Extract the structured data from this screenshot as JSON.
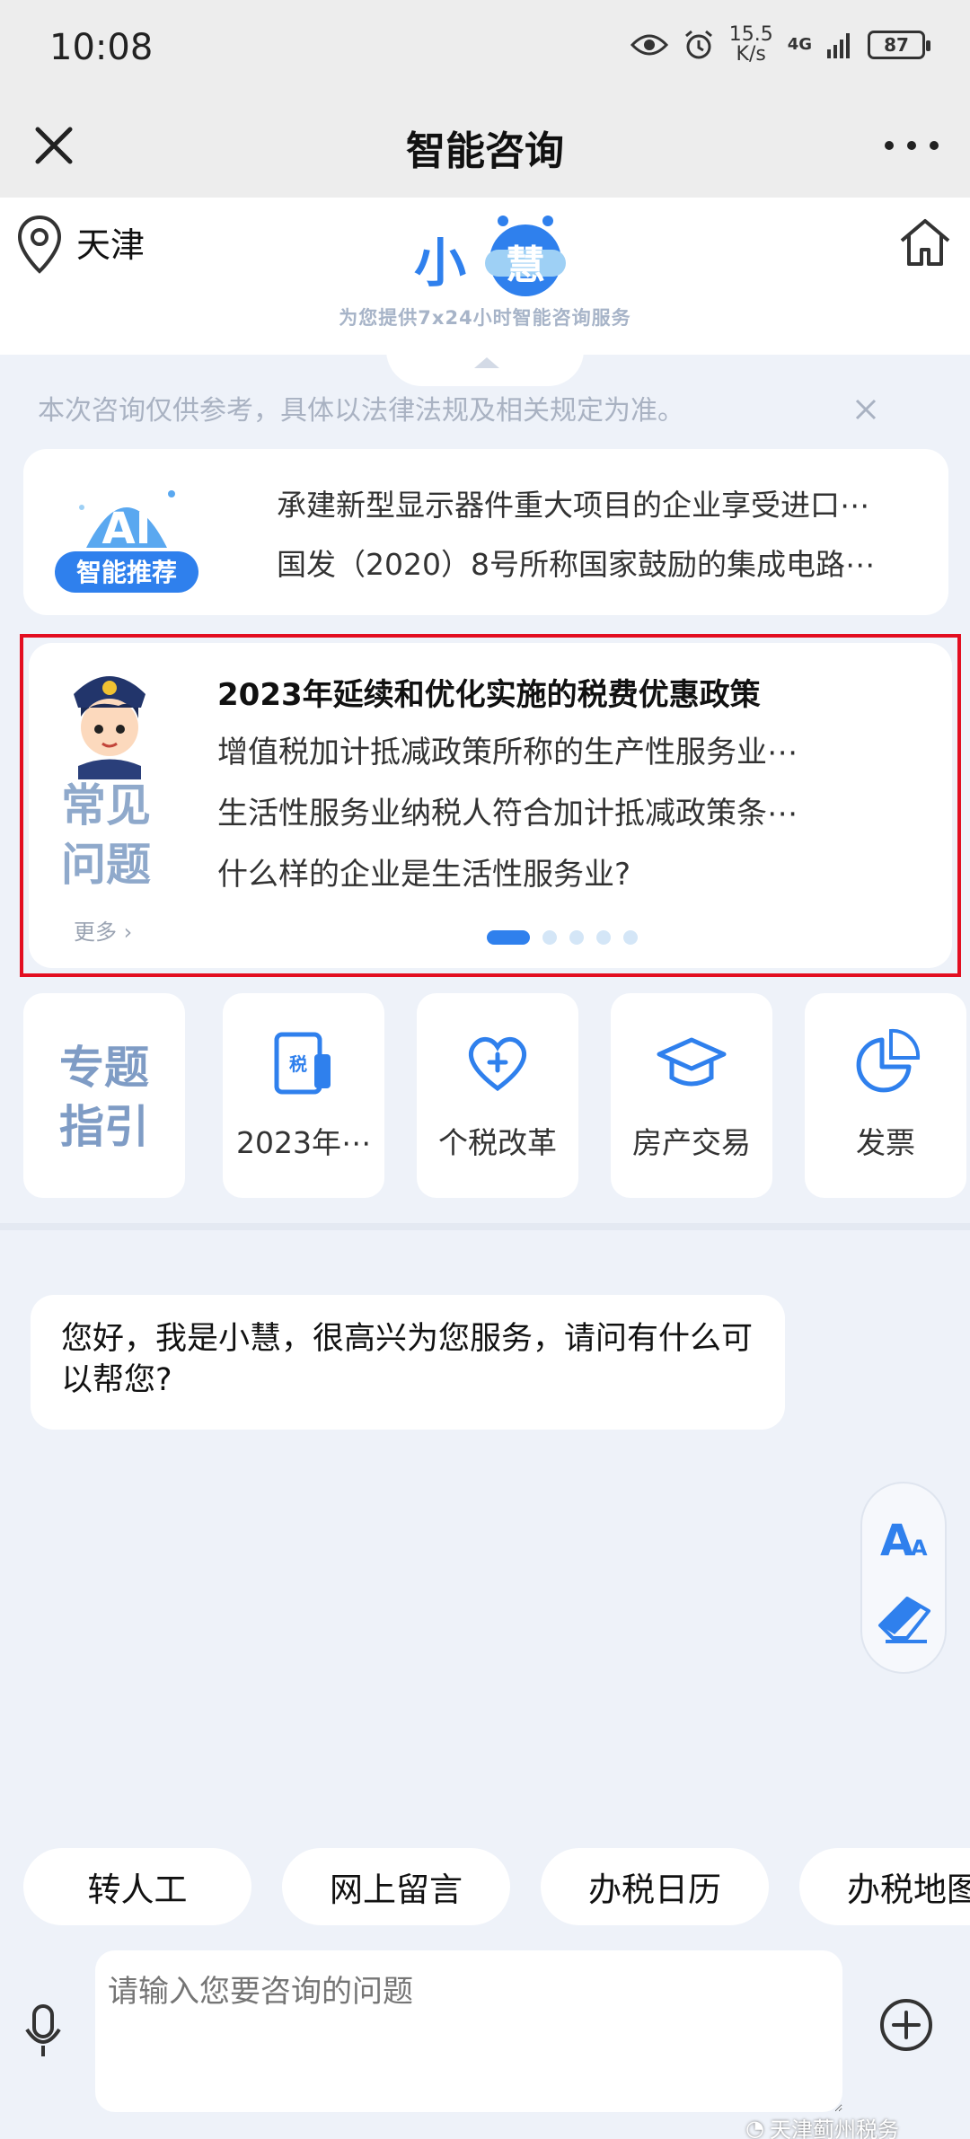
{
  "status": {
    "time": "10:08",
    "net_speed_value": "15.5",
    "net_speed_unit": "K/s",
    "network": "4G",
    "battery": "87"
  },
  "titlebar": {
    "title": "智能咨询"
  },
  "header": {
    "location": "天津",
    "logo_text_left": "小",
    "logo_text_right": "慧",
    "subtitle": "为您提供7x24小时智能咨询服务"
  },
  "disclaimer": "本次咨询仅供参考，具体以法律法规及相关规定为准。",
  "recommend": {
    "badge": "智能推荐",
    "logo_letters": "AI",
    "items": [
      "承建新型显示器件重大项目的企业享受进口⋯",
      "国发（2020）8号所称国家鼓励的集成电路⋯"
    ]
  },
  "faq": {
    "label": "常见问题",
    "label_line1": "常见",
    "label_line2": "问题",
    "more": "更多",
    "title": "2023年延续和优化实施的税费优惠政策",
    "items": [
      "增值税加计抵减政策所称的生产性服务业⋯",
      "生活性服务业纳税人符合加计抵减政策条⋯",
      "什么样的企业是生活性服务业?"
    ],
    "page_count": 5,
    "active_page": 1
  },
  "topics": {
    "label_line1": "专题",
    "label_line2": "指引",
    "categories": [
      {
        "label": "2023年⋯",
        "icon": "tax-document-icon"
      },
      {
        "label": "个税改革",
        "icon": "heart-plus-icon"
      },
      {
        "label": "房产交易",
        "icon": "graduation-cap-icon"
      },
      {
        "label": "发票",
        "icon": "pie-chart-icon"
      }
    ]
  },
  "chat": {
    "greeting": "您好，我是小慧，很高兴为您服务，请问有什么可以帮您?"
  },
  "tools": {
    "font_icon": "font-size-icon",
    "eraser_icon": "eraser-icon"
  },
  "quick_actions": [
    "转人工",
    "网上留言",
    "办税日历",
    "办税地图"
  ],
  "input": {
    "placeholder": "请输入您要咨询的问题"
  },
  "watermark": "天津蓟州税务",
  "colors": {
    "accent": "#2f80ed",
    "highlight_border": "#e30e21",
    "background": "#eef2f9",
    "topic_text": "#7f9cc5"
  }
}
